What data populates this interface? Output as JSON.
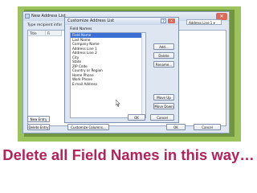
{
  "colors": {
    "frame_green": "#9bc55c",
    "caption_color": "#b2225b",
    "selection_blue": "#3b6fd4"
  },
  "back_dialog": {
    "title": "New Address List",
    "subtitle": "Type recipient infor",
    "col_title": "Title",
    "col_first": "Fi",
    "address_dropdown": "Address Line 1",
    "buttons": {
      "new_entry": "New Entry",
      "delete_entry": "Delete Entry",
      "customize_columns": "Customize Columns...",
      "ok": "OK",
      "cancel": "Cancel"
    }
  },
  "customize_dialog": {
    "title": "Customize Address List",
    "help": "?",
    "close": "x",
    "field_names_label": "Field Names",
    "field_names": [
      "Field Name",
      "Last Name",
      "Company Name",
      "Address Line 1",
      "Address Line 2",
      "City",
      "State",
      "ZIP Code",
      "Country or Region",
      "Home Phone",
      "Work Phone",
      "E-mail Address"
    ],
    "selected_index": 0,
    "buttons": {
      "add": "Add...",
      "delete": "Delete",
      "rename": "Rename...",
      "move_up": "Move Up",
      "move_down": "Move Down",
      "ok": "OK",
      "cancel": "Cancel"
    }
  },
  "caption": "Delete all Field Names in this way…"
}
